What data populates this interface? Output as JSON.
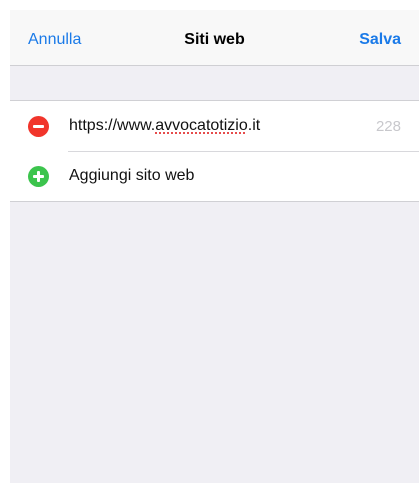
{
  "nav": {
    "cancel_label": "Annulla",
    "title": "Siti web",
    "save_label": "Salva"
  },
  "websites": {
    "items": [
      {
        "url_prefix": "https://www.",
        "url_misspelled": "avvocatotizio",
        "url_suffix": ".it",
        "count": "228",
        "action_icon": "remove-circle-icon"
      }
    ],
    "add_label": "Aggiungi sito web",
    "add_icon": "add-circle-icon"
  },
  "colors": {
    "accent": "#1a7ae8",
    "remove": "#f1352b",
    "add": "#3cc44d",
    "background": "#f0eff4"
  }
}
